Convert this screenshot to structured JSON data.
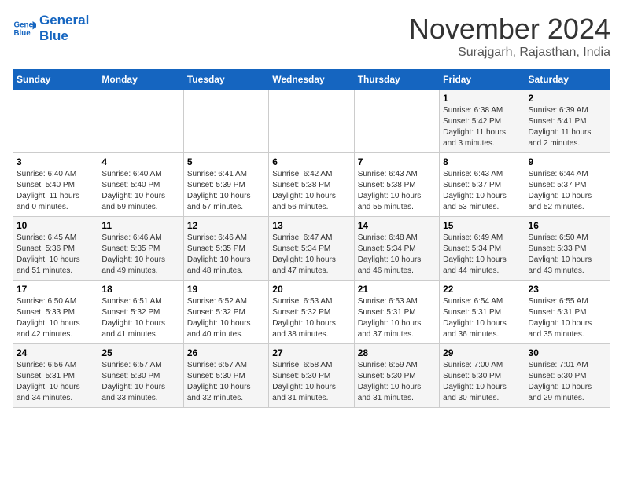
{
  "header": {
    "logo_line1": "General",
    "logo_line2": "Blue",
    "month": "November 2024",
    "location": "Surajgarh, Rajasthan, India"
  },
  "weekdays": [
    "Sunday",
    "Monday",
    "Tuesday",
    "Wednesday",
    "Thursday",
    "Friday",
    "Saturday"
  ],
  "weeks": [
    [
      {
        "day": "",
        "info": ""
      },
      {
        "day": "",
        "info": ""
      },
      {
        "day": "",
        "info": ""
      },
      {
        "day": "",
        "info": ""
      },
      {
        "day": "",
        "info": ""
      },
      {
        "day": "1",
        "info": "Sunrise: 6:38 AM\nSunset: 5:42 PM\nDaylight: 11 hours\nand 3 minutes."
      },
      {
        "day": "2",
        "info": "Sunrise: 6:39 AM\nSunset: 5:41 PM\nDaylight: 11 hours\nand 2 minutes."
      }
    ],
    [
      {
        "day": "3",
        "info": "Sunrise: 6:40 AM\nSunset: 5:40 PM\nDaylight: 11 hours\nand 0 minutes."
      },
      {
        "day": "4",
        "info": "Sunrise: 6:40 AM\nSunset: 5:40 PM\nDaylight: 10 hours\nand 59 minutes."
      },
      {
        "day": "5",
        "info": "Sunrise: 6:41 AM\nSunset: 5:39 PM\nDaylight: 10 hours\nand 57 minutes."
      },
      {
        "day": "6",
        "info": "Sunrise: 6:42 AM\nSunset: 5:38 PM\nDaylight: 10 hours\nand 56 minutes."
      },
      {
        "day": "7",
        "info": "Sunrise: 6:43 AM\nSunset: 5:38 PM\nDaylight: 10 hours\nand 55 minutes."
      },
      {
        "day": "8",
        "info": "Sunrise: 6:43 AM\nSunset: 5:37 PM\nDaylight: 10 hours\nand 53 minutes."
      },
      {
        "day": "9",
        "info": "Sunrise: 6:44 AM\nSunset: 5:37 PM\nDaylight: 10 hours\nand 52 minutes."
      }
    ],
    [
      {
        "day": "10",
        "info": "Sunrise: 6:45 AM\nSunset: 5:36 PM\nDaylight: 10 hours\nand 51 minutes."
      },
      {
        "day": "11",
        "info": "Sunrise: 6:46 AM\nSunset: 5:35 PM\nDaylight: 10 hours\nand 49 minutes."
      },
      {
        "day": "12",
        "info": "Sunrise: 6:46 AM\nSunset: 5:35 PM\nDaylight: 10 hours\nand 48 minutes."
      },
      {
        "day": "13",
        "info": "Sunrise: 6:47 AM\nSunset: 5:34 PM\nDaylight: 10 hours\nand 47 minutes."
      },
      {
        "day": "14",
        "info": "Sunrise: 6:48 AM\nSunset: 5:34 PM\nDaylight: 10 hours\nand 46 minutes."
      },
      {
        "day": "15",
        "info": "Sunrise: 6:49 AM\nSunset: 5:34 PM\nDaylight: 10 hours\nand 44 minutes."
      },
      {
        "day": "16",
        "info": "Sunrise: 6:50 AM\nSunset: 5:33 PM\nDaylight: 10 hours\nand 43 minutes."
      }
    ],
    [
      {
        "day": "17",
        "info": "Sunrise: 6:50 AM\nSunset: 5:33 PM\nDaylight: 10 hours\nand 42 minutes."
      },
      {
        "day": "18",
        "info": "Sunrise: 6:51 AM\nSunset: 5:32 PM\nDaylight: 10 hours\nand 41 minutes."
      },
      {
        "day": "19",
        "info": "Sunrise: 6:52 AM\nSunset: 5:32 PM\nDaylight: 10 hours\nand 40 minutes."
      },
      {
        "day": "20",
        "info": "Sunrise: 6:53 AM\nSunset: 5:32 PM\nDaylight: 10 hours\nand 38 minutes."
      },
      {
        "day": "21",
        "info": "Sunrise: 6:53 AM\nSunset: 5:31 PM\nDaylight: 10 hours\nand 37 minutes."
      },
      {
        "day": "22",
        "info": "Sunrise: 6:54 AM\nSunset: 5:31 PM\nDaylight: 10 hours\nand 36 minutes."
      },
      {
        "day": "23",
        "info": "Sunrise: 6:55 AM\nSunset: 5:31 PM\nDaylight: 10 hours\nand 35 minutes."
      }
    ],
    [
      {
        "day": "24",
        "info": "Sunrise: 6:56 AM\nSunset: 5:31 PM\nDaylight: 10 hours\nand 34 minutes."
      },
      {
        "day": "25",
        "info": "Sunrise: 6:57 AM\nSunset: 5:30 PM\nDaylight: 10 hours\nand 33 minutes."
      },
      {
        "day": "26",
        "info": "Sunrise: 6:57 AM\nSunset: 5:30 PM\nDaylight: 10 hours\nand 32 minutes."
      },
      {
        "day": "27",
        "info": "Sunrise: 6:58 AM\nSunset: 5:30 PM\nDaylight: 10 hours\nand 31 minutes."
      },
      {
        "day": "28",
        "info": "Sunrise: 6:59 AM\nSunset: 5:30 PM\nDaylight: 10 hours\nand 31 minutes."
      },
      {
        "day": "29",
        "info": "Sunrise: 7:00 AM\nSunset: 5:30 PM\nDaylight: 10 hours\nand 30 minutes."
      },
      {
        "day": "30",
        "info": "Sunrise: 7:01 AM\nSunset: 5:30 PM\nDaylight: 10 hours\nand 29 minutes."
      }
    ]
  ]
}
